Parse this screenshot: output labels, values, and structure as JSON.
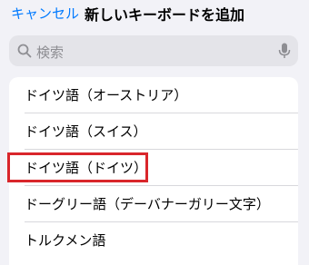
{
  "header": {
    "cancel_label": "キャンセル",
    "title": "新しいキーボードを追加"
  },
  "search": {
    "placeholder": "検索",
    "icon": "search-icon",
    "mic_icon": "microphone-icon"
  },
  "languages": [
    {
      "label": "ドイツ語（オーストリア）"
    },
    {
      "label": "ドイツ語（スイス）"
    },
    {
      "label": "ドイツ語（ドイツ）",
      "highlighted": true
    },
    {
      "label": "ドーグリー語（デーバナーガリー文字）"
    },
    {
      "label": "トルクメン語"
    }
  ],
  "colors": {
    "accent": "#007aff",
    "highlight_border": "#d9262b",
    "background": "#f2f2f7"
  }
}
